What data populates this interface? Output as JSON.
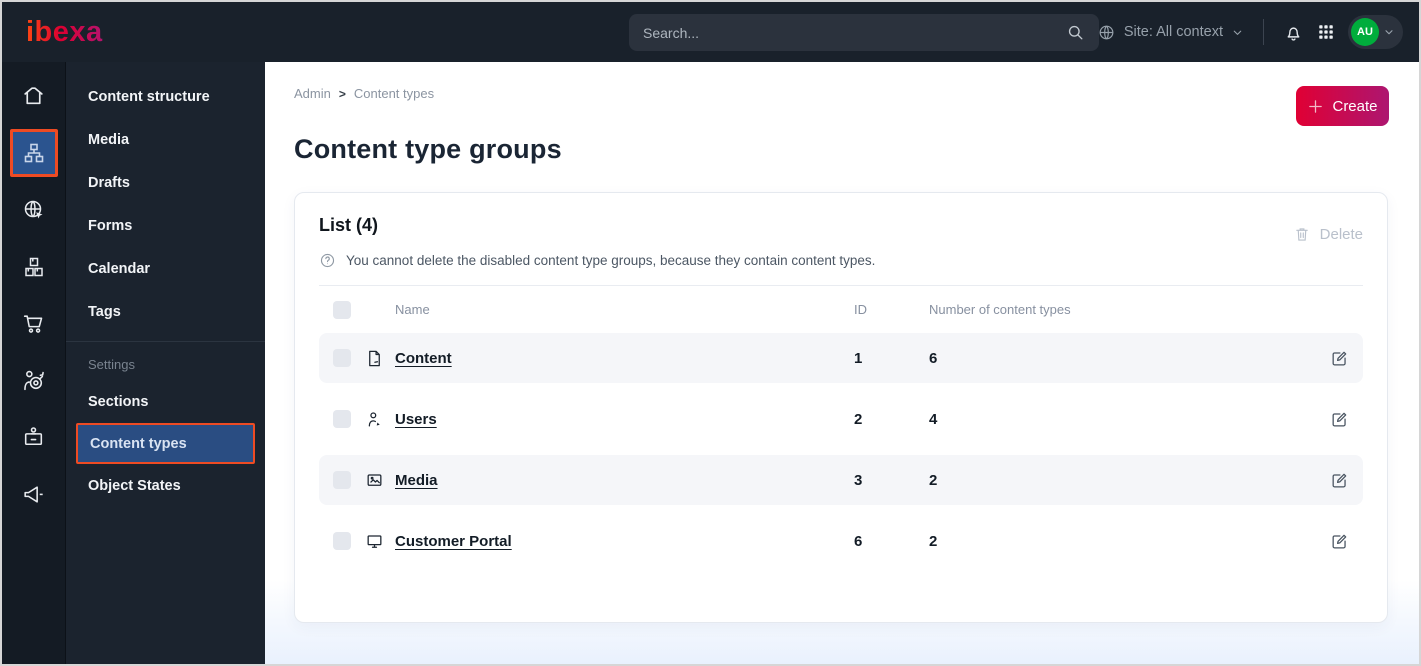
{
  "topbar": {
    "logo": "ibexa",
    "search": {
      "placeholder": "Search..."
    },
    "site_selector": "Site: All context",
    "avatar_initials": "AU"
  },
  "icon_rail": {
    "items": [
      "home-icon",
      "content-tree-icon",
      "site-globe-icon",
      "product-boxes-icon",
      "cart-icon",
      "personalization-target-icon",
      "admin-badge-icon",
      "megaphone-icon"
    ],
    "active": "content-tree-icon"
  },
  "sidebar": {
    "items": [
      {
        "label": "Content structure"
      },
      {
        "label": "Media"
      },
      {
        "label": "Drafts"
      },
      {
        "label": "Forms"
      },
      {
        "label": "Calendar"
      },
      {
        "label": "Tags"
      }
    ],
    "settings_label": "Settings",
    "settings_items": [
      {
        "label": "Sections"
      },
      {
        "label": "Content types"
      },
      {
        "label": "Object States"
      }
    ],
    "active_item": "Content types"
  },
  "breadcrumb": {
    "items": [
      {
        "label": "Admin"
      },
      {
        "label": "Content types"
      }
    ],
    "separator": ">"
  },
  "page": {
    "title": "Content type groups",
    "create_label": "Create"
  },
  "list": {
    "title": "List (4)",
    "delete_label": "Delete",
    "info": "You cannot delete the disabled content type groups, because they contain content types.",
    "columns": {
      "name": "Name",
      "id": "ID",
      "count": "Number of content types"
    },
    "rows": [
      {
        "icon": "file-icon",
        "name": "Content",
        "id": "1",
        "count": "6"
      },
      {
        "icon": "user-icon",
        "name": "Users",
        "id": "2",
        "count": "4"
      },
      {
        "icon": "image-icon",
        "name": "Media",
        "id": "3",
        "count": "2"
      },
      {
        "icon": "monitor-icon",
        "name": "Customer Portal",
        "id": "6",
        "count": "2"
      }
    ]
  },
  "colors": {
    "topbar_bg": "#19212b",
    "rail_bg": "#141b24",
    "menu_bg": "#1b232e",
    "active_highlight_border": "#ee4b23",
    "active_highlight_bg": "#2a4d82",
    "create_gradient_start": "#e00034",
    "create_gradient_end": "#ad1670",
    "avatar_green": "#00ad3c",
    "row_stripe": "#f5f6f9"
  }
}
